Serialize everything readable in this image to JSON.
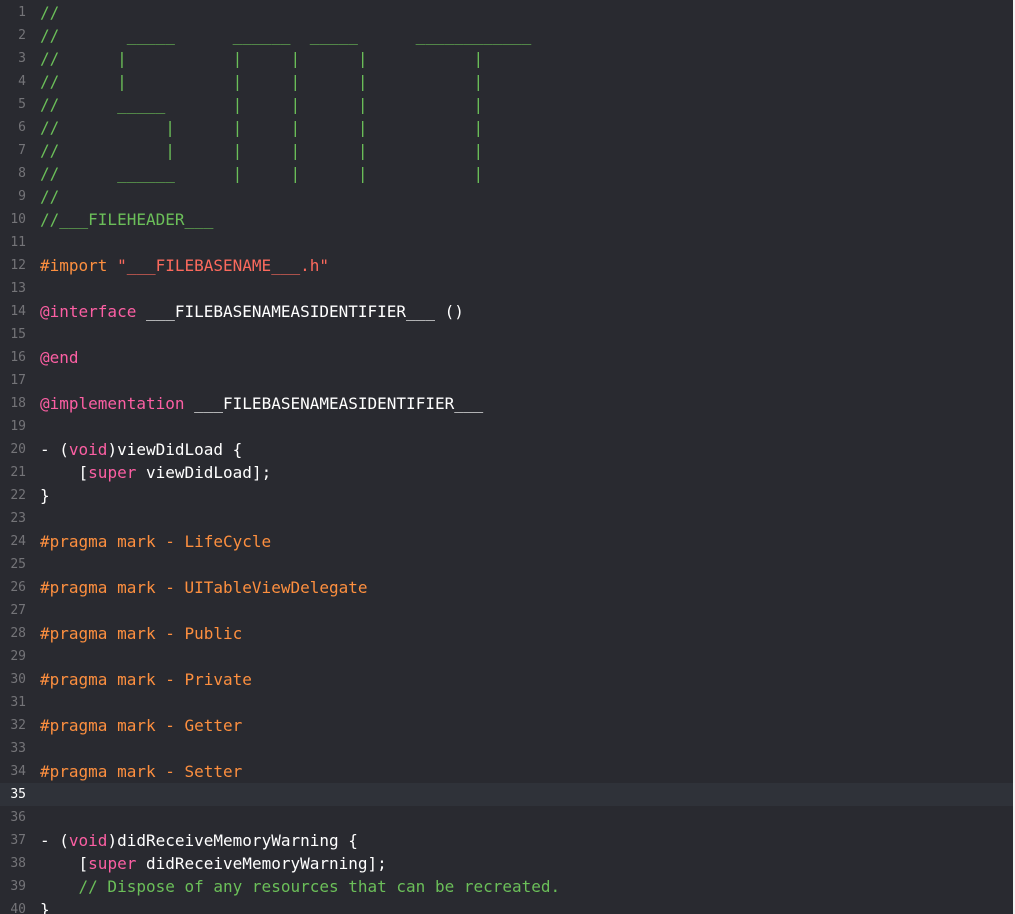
{
  "colors": {
    "background": "#292a30",
    "current_line": "#2f3239",
    "line_number": "#747478",
    "comment": "#6bbf59",
    "directive": "#fd8f3f",
    "string": "#fc6a5d",
    "keyword": "#fc5fa3",
    "plain": "#ffffff"
  },
  "current_line": 35,
  "lines": [
    {
      "n": "1",
      "tokens": [
        {
          "t": "//",
          "c": "comment"
        }
      ]
    },
    {
      "n": "2",
      "tokens": [
        {
          "t": "//       _____      ______  _____      ____________",
          "c": "comment"
        }
      ]
    },
    {
      "n": "3",
      "tokens": [
        {
          "t": "//      |           |     |      |           |",
          "c": "comment"
        }
      ]
    },
    {
      "n": "4",
      "tokens": [
        {
          "t": "//      |           |     |      |           |",
          "c": "comment"
        }
      ]
    },
    {
      "n": "5",
      "tokens": [
        {
          "t": "//      _____       |     |      |           |",
          "c": "comment"
        }
      ]
    },
    {
      "n": "6",
      "tokens": [
        {
          "t": "//           |      |     |      |           |",
          "c": "comment"
        }
      ]
    },
    {
      "n": "7",
      "tokens": [
        {
          "t": "//           |      |     |      |           |",
          "c": "comment"
        }
      ]
    },
    {
      "n": "8",
      "tokens": [
        {
          "t": "//      ______      |     |      |           |",
          "c": "comment"
        }
      ]
    },
    {
      "n": "9",
      "tokens": [
        {
          "t": "//",
          "c": "comment"
        }
      ]
    },
    {
      "n": "10",
      "tokens": [
        {
          "t": "//___FILEHEADER___",
          "c": "comment"
        }
      ]
    },
    {
      "n": "11",
      "tokens": []
    },
    {
      "n": "12",
      "tokens": [
        {
          "t": "#import ",
          "c": "directive"
        },
        {
          "t": "\"___FILEBASENAME___.h\"",
          "c": "string"
        }
      ]
    },
    {
      "n": "13",
      "tokens": []
    },
    {
      "n": "14",
      "tokens": [
        {
          "t": "@interface",
          "c": "keyword"
        },
        {
          "t": " ___FILEBASENAMEASIDENTIFIER___ ()",
          "c": "plain"
        }
      ]
    },
    {
      "n": "15",
      "tokens": []
    },
    {
      "n": "16",
      "tokens": [
        {
          "t": "@end",
          "c": "keyword"
        }
      ]
    },
    {
      "n": "17",
      "tokens": []
    },
    {
      "n": "18",
      "tokens": [
        {
          "t": "@implementation",
          "c": "keyword"
        },
        {
          "t": " ___FILEBASENAMEASIDENTIFIER___",
          "c": "plain"
        }
      ]
    },
    {
      "n": "19",
      "tokens": []
    },
    {
      "n": "20",
      "tokens": [
        {
          "t": "- (",
          "c": "plain"
        },
        {
          "t": "void",
          "c": "keyword"
        },
        {
          "t": ")viewDidLoad {",
          "c": "plain"
        }
      ]
    },
    {
      "n": "21",
      "tokens": [
        {
          "t": "    [",
          "c": "plain"
        },
        {
          "t": "super",
          "c": "keyword"
        },
        {
          "t": " viewDidLoad];",
          "c": "plain"
        }
      ]
    },
    {
      "n": "22",
      "tokens": [
        {
          "t": "}",
          "c": "plain"
        }
      ]
    },
    {
      "n": "23",
      "tokens": []
    },
    {
      "n": "24",
      "tokens": [
        {
          "t": "#pragma mark - LifeCycle",
          "c": "directive"
        }
      ]
    },
    {
      "n": "25",
      "tokens": []
    },
    {
      "n": "26",
      "tokens": [
        {
          "t": "#pragma mark - UITableViewDelegate",
          "c": "directive"
        }
      ]
    },
    {
      "n": "27",
      "tokens": []
    },
    {
      "n": "28",
      "tokens": [
        {
          "t": "#pragma mark - Public",
          "c": "directive"
        }
      ]
    },
    {
      "n": "29",
      "tokens": []
    },
    {
      "n": "30",
      "tokens": [
        {
          "t": "#pragma mark - Private",
          "c": "directive"
        }
      ]
    },
    {
      "n": "31",
      "tokens": []
    },
    {
      "n": "32",
      "tokens": [
        {
          "t": "#pragma mark - Getter",
          "c": "directive"
        }
      ]
    },
    {
      "n": "33",
      "tokens": []
    },
    {
      "n": "34",
      "tokens": [
        {
          "t": "#pragma mark - Setter",
          "c": "directive"
        }
      ]
    },
    {
      "n": "35",
      "tokens": []
    },
    {
      "n": "36",
      "tokens": []
    },
    {
      "n": "37",
      "tokens": [
        {
          "t": "- (",
          "c": "plain"
        },
        {
          "t": "void",
          "c": "keyword"
        },
        {
          "t": ")didReceiveMemoryWarning {",
          "c": "plain"
        }
      ]
    },
    {
      "n": "38",
      "tokens": [
        {
          "t": "    [",
          "c": "plain"
        },
        {
          "t": "super",
          "c": "keyword"
        },
        {
          "t": " didReceiveMemoryWarning];",
          "c": "plain"
        }
      ]
    },
    {
      "n": "39",
      "tokens": [
        {
          "t": "    // Dispose of any resources that can be recreated.",
          "c": "comment"
        }
      ]
    },
    {
      "n": "40",
      "tokens": [
        {
          "t": "}",
          "c": "plain"
        }
      ]
    }
  ]
}
